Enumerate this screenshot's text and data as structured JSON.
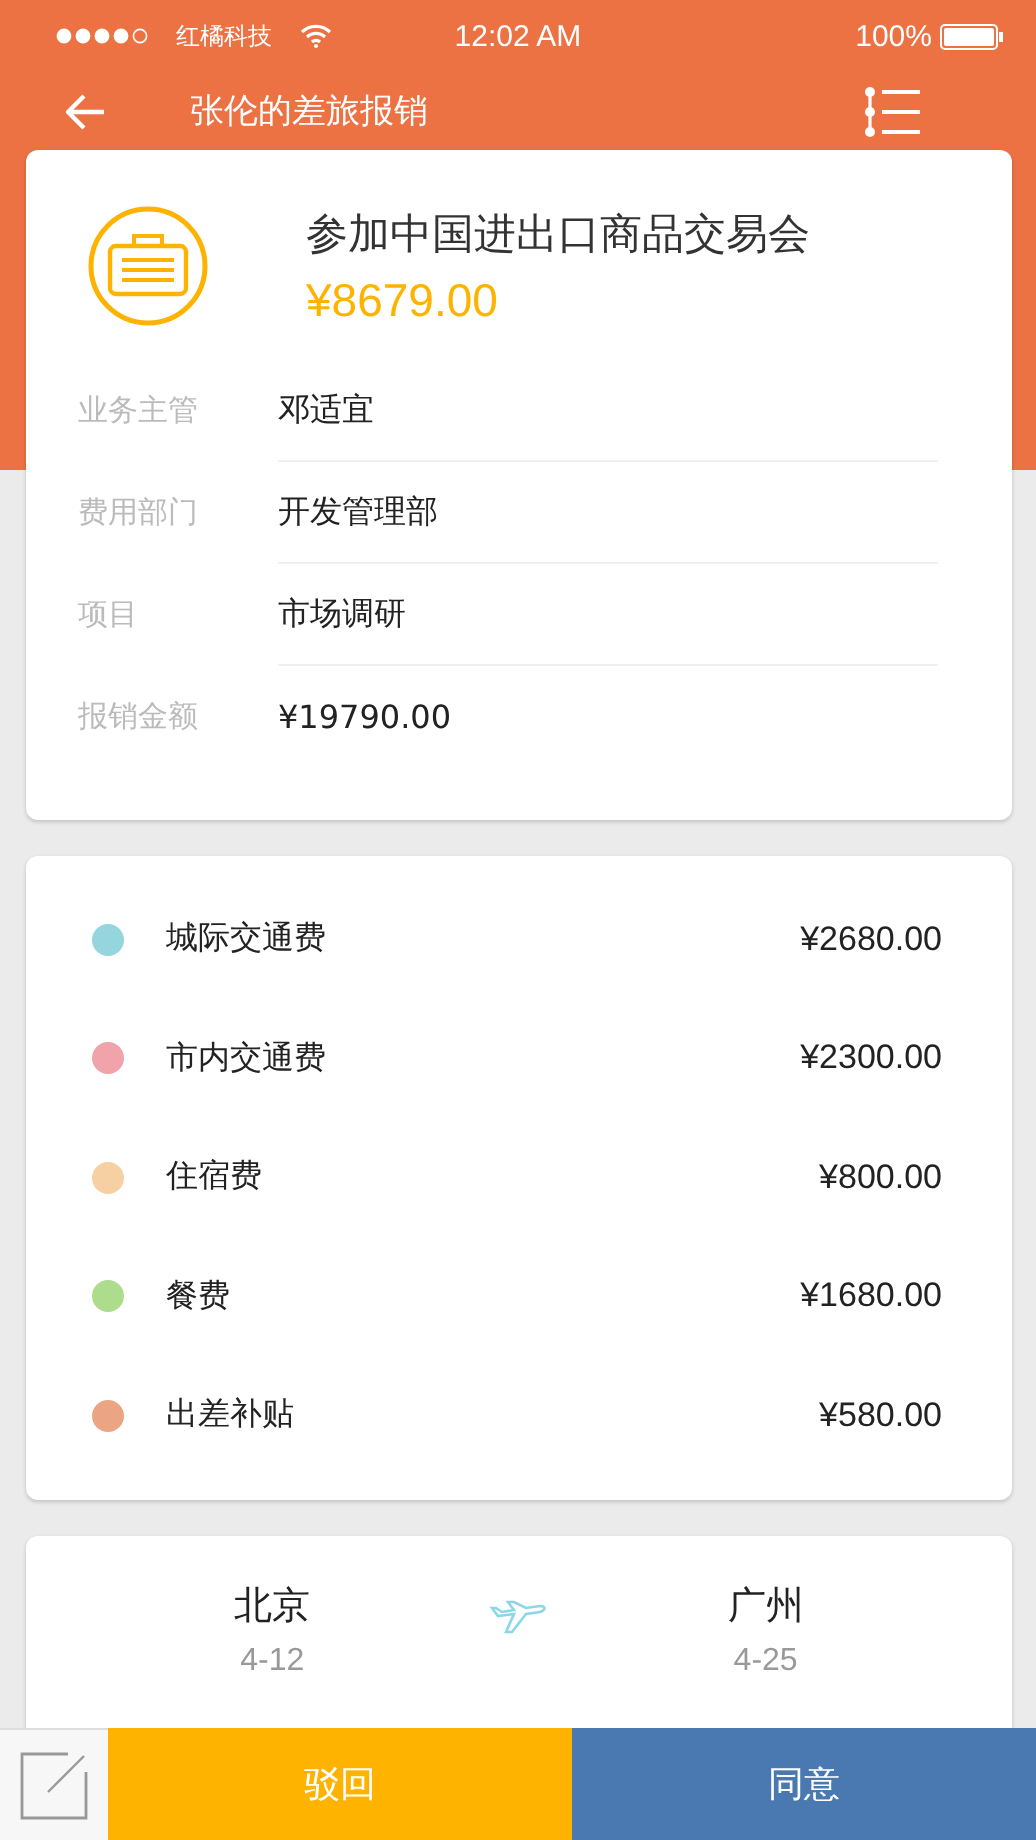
{
  "status_bar": {
    "carrier": "红橘科技",
    "time": "12:02 AM",
    "battery": "100%"
  },
  "nav": {
    "title": "张伦的差旅报销"
  },
  "summary": {
    "title": "参加中国进出口商品交易会",
    "amount": "¥8679.00",
    "fields": [
      {
        "label": "业务主管",
        "value": "邓适宜"
      },
      {
        "label": "费用部门",
        "value": "开发管理部"
      },
      {
        "label": "项目",
        "value": "市场调研"
      },
      {
        "label": "报销金额",
        "value": "¥19790.00"
      }
    ]
  },
  "expenses": [
    {
      "name": "城际交通费",
      "amount": "¥2680.00",
      "color": "#94d5de"
    },
    {
      "name": "市内交通费",
      "amount": "¥2300.00",
      "color": "#f0a3aa"
    },
    {
      "name": "住宿费",
      "amount": "¥800.00",
      "color": "#f6d0a2"
    },
    {
      "name": "餐费",
      "amount": "¥1680.00",
      "color": "#acdc8c"
    },
    {
      "name": "出差补贴",
      "amount": "¥580.00",
      "color": "#eba584"
    }
  ],
  "trip": {
    "from": {
      "city": "北京",
      "date": "4-12"
    },
    "to": {
      "city": "广州",
      "date": "4-25"
    }
  },
  "actions": {
    "reject": "驳回",
    "approve": "同意"
  }
}
